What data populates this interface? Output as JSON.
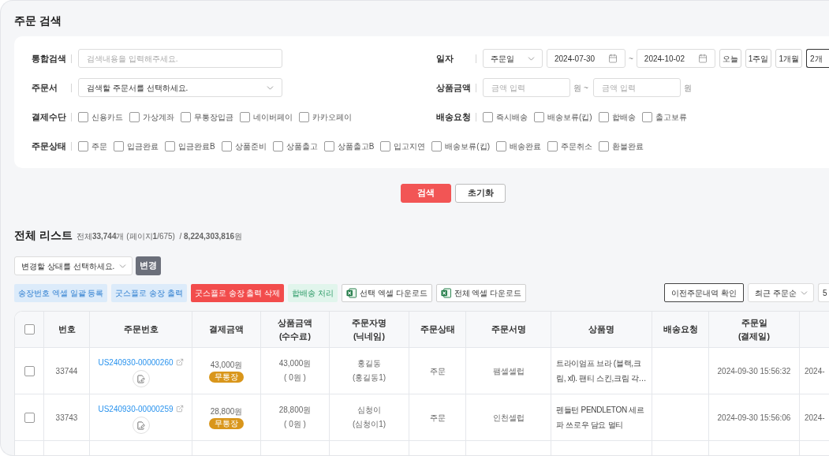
{
  "page_title": "주문 검색",
  "search_form": {
    "rows": [
      {
        "fields": [
          {
            "kind": "text",
            "label": "통합검색",
            "placeholder": "검색내용을 입력해주세요."
          },
          {
            "kind": "date_range",
            "label": "일자",
            "date_type": "주문일",
            "from": "2024-07-30",
            "separator": "~",
            "to": "2024-10-02",
            "periods": [
              {
                "label": "오늘",
                "selected": false
              },
              {
                "label": "1주일",
                "selected": false
              },
              {
                "label": "1개월",
                "selected": false
              },
              {
                "label": "2개",
                "selected": true
              }
            ]
          }
        ]
      },
      {
        "fields": [
          {
            "kind": "select",
            "label": "주문서",
            "value": "검색할 주문서를 선택하세요."
          },
          {
            "kind": "amount_range",
            "label": "상품금액",
            "from_placeholder": "금액 입력",
            "from_unit": "원",
            "separator": "~",
            "to_placeholder": "금액 입력",
            "to_unit": "원"
          }
        ]
      },
      {
        "fields": [
          {
            "kind": "checkboxes",
            "label": "결제수단",
            "options": [
              {
                "label": "신용카드",
                "checked": false
              },
              {
                "label": "가상계좌",
                "checked": false
              },
              {
                "label": "무통장입금",
                "checked": false
              },
              {
                "label": "네이버페이",
                "checked": false
              },
              {
                "label": "카카오페이",
                "checked": false
              }
            ]
          },
          {
            "kind": "checkboxes",
            "label": "배송요청",
            "options": [
              {
                "label": "즉시배송",
                "checked": false
              },
              {
                "label": "배송보류(킵)",
                "checked": false
              },
              {
                "label": "합배송",
                "checked": false
              },
              {
                "label": "출고보류",
                "checked": false
              }
            ]
          }
        ]
      },
      {
        "fields": [
          {
            "kind": "checkboxes",
            "label": "주문상태",
            "options": [
              {
                "label": "주문",
                "checked": false
              },
              {
                "label": "입금완료",
                "checked": false
              },
              {
                "label": "입금완료B",
                "checked": false
              },
              {
                "label": "상품준비",
                "checked": false
              },
              {
                "label": "상품출고",
                "checked": false
              },
              {
                "label": "상품출고B",
                "checked": false
              },
              {
                "label": "입고지연",
                "checked": false
              },
              {
                "label": "배송보류(킵)",
                "checked": false
              },
              {
                "label": "배송완료",
                "checked": false
              },
              {
                "label": "주문취소",
                "checked": false
              },
              {
                "label": "환불완료",
                "checked": false
              }
            ]
          }
        ]
      }
    ],
    "buttons": [
      {
        "label": "검색",
        "kind": "primary"
      },
      {
        "label": "초기화",
        "kind": "secondary"
      }
    ]
  },
  "list": {
    "title": "전체 리스트",
    "summary": "전체**33,744**개 (페이지**1**/675)  / **8,224,303,816**원",
    "status_select": {
      "value": "변경할 상태를 선택하세요."
    },
    "apply_button": "변경",
    "actions": [
      {
        "label": "송장번호 엑셀 일괄 등록",
        "kind": "info"
      },
      {
        "label": "굿스플로 송장 출력",
        "kind": "info"
      },
      {
        "label": "굿스플로 송장 출력 삭제",
        "kind": "danger"
      },
      {
        "label": "합배송 처리",
        "kind": "success"
      },
      {
        "label": "선택 엑셀 다운로드",
        "kind": "excel"
      },
      {
        "label": "전체 엑셀 다운로드",
        "kind": "excel"
      }
    ],
    "right_actions": [
      {
        "label": "이전주문내역 확인",
        "kind": "button"
      },
      {
        "label": "최근 주문순",
        "kind": "select"
      },
      {
        "label": "5",
        "kind": "select"
      }
    ],
    "table": {
      "select_all": {
        "checked": false
      },
      "columns": [
        {
          "lines": [
            "번호"
          ]
        },
        {
          "lines": [
            "주문번호"
          ]
        },
        {
          "lines": [
            "결제금액"
          ]
        },
        {
          "lines": [
            "상품금액",
            "(수수료)"
          ]
        },
        {
          "lines": [
            "주문자명",
            "(닉네임)"
          ]
        },
        {
          "lines": [
            "주문상태"
          ]
        },
        {
          "lines": [
            "주문서명"
          ]
        },
        {
          "lines": [
            "상품명"
          ]
        },
        {
          "lines": [
            "배송요청"
          ]
        },
        {
          "lines": [
            "주문일",
            "(결제일)"
          ]
        }
      ],
      "rows": [
        {
          "checked": false,
          "no": "33744",
          "order_no": "US240930-00000260",
          "payment": "43,000원",
          "payment_method": "무통장",
          "product_amount": "43,000원",
          "fee": "( 0원 )",
          "orderer": "홍길동",
          "nickname": "(홍길동1)",
          "status": "주문",
          "form_name": "팸셀셀럽",
          "product": "트라이엄프 브라 (블랙,크림, xl). 팬티 스킨,크림 각…",
          "order_date": "2024-09-30 15:56:32",
          "column_12": "2024-"
        },
        {
          "checked": false,
          "no": "33743",
          "order_no": "US240930-00000259",
          "payment": "28,800원",
          "payment_method": "무통장",
          "product_amount": "28,800원",
          "fee": "( 0원 )",
          "orderer": "심청이",
          "nickname": "(심청이1)",
          "status": "주문",
          "form_name": "인천셀럽",
          "product": "펜들턴 PENDLETON 세르파 쓰로우 담요 멀티",
          "order_date": "2024-09-30 15:56:06",
          "column_12": "2024-"
        }
      ]
    }
  }
}
